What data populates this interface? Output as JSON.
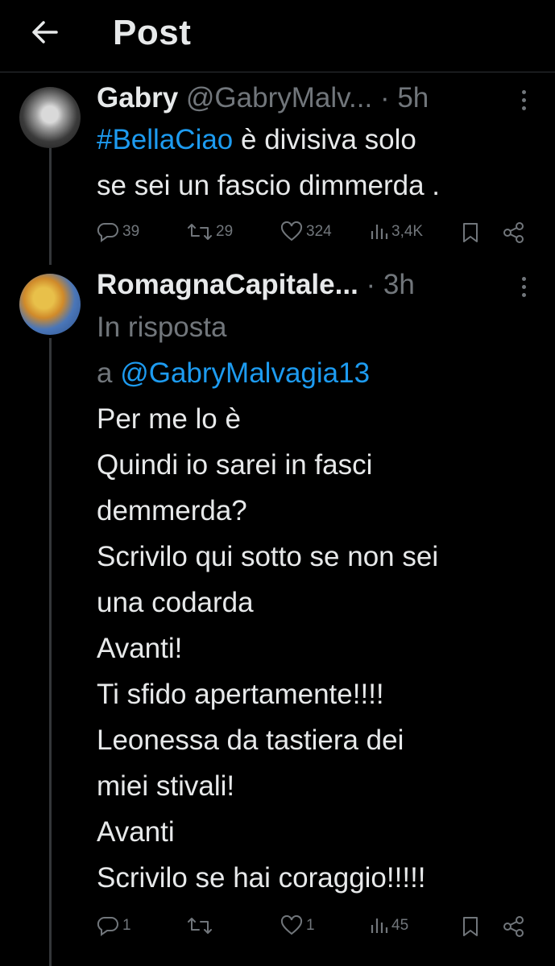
{
  "header": {
    "title": "Post"
  },
  "tweet1": {
    "name": "Gabry",
    "handle": "@GabryMalv...",
    "sep_time": "· 5h",
    "hashtag": "#BellaCiao",
    "line1_rest": " è divisiva solo",
    "line2": "se sei un fascio dimmerda .",
    "replies": "39",
    "reposts": "29",
    "likes": "324",
    "views": "3,4K"
  },
  "tweet2": {
    "name": "RomagnaCapitale...",
    "sep_time": "· 3h",
    "reply_prefix": "In risposta",
    "reply_a": "a ",
    "reply_handle": "@GabryMalvagia13",
    "lines": [
      "Per me lo è",
      "Quindi io sarei in fasci",
      "demmerda?",
      "Scrivilo qui sotto se non sei",
      "una codarda",
      "Avanti!",
      "Ti sfido apertamente!!!!",
      "Leonessa da tastiera dei",
      "miei stivali!",
      "Avanti",
      "Scrivilo se hai coraggio!!!!!"
    ],
    "replies": "1",
    "reposts": "",
    "likes": "1",
    "views": "45"
  },
  "icons": {
    "back": "arrow-left-icon",
    "reply": "reply-icon",
    "repost": "repost-icon",
    "like": "heart-icon",
    "views": "views-icon",
    "bookmark": "bookmark-icon",
    "share": "share-icon",
    "more": "more-icon"
  },
  "colors": {
    "background": "#000000",
    "text": "#e7e9ea",
    "muted": "#71767b",
    "link": "#1d9bf0"
  }
}
